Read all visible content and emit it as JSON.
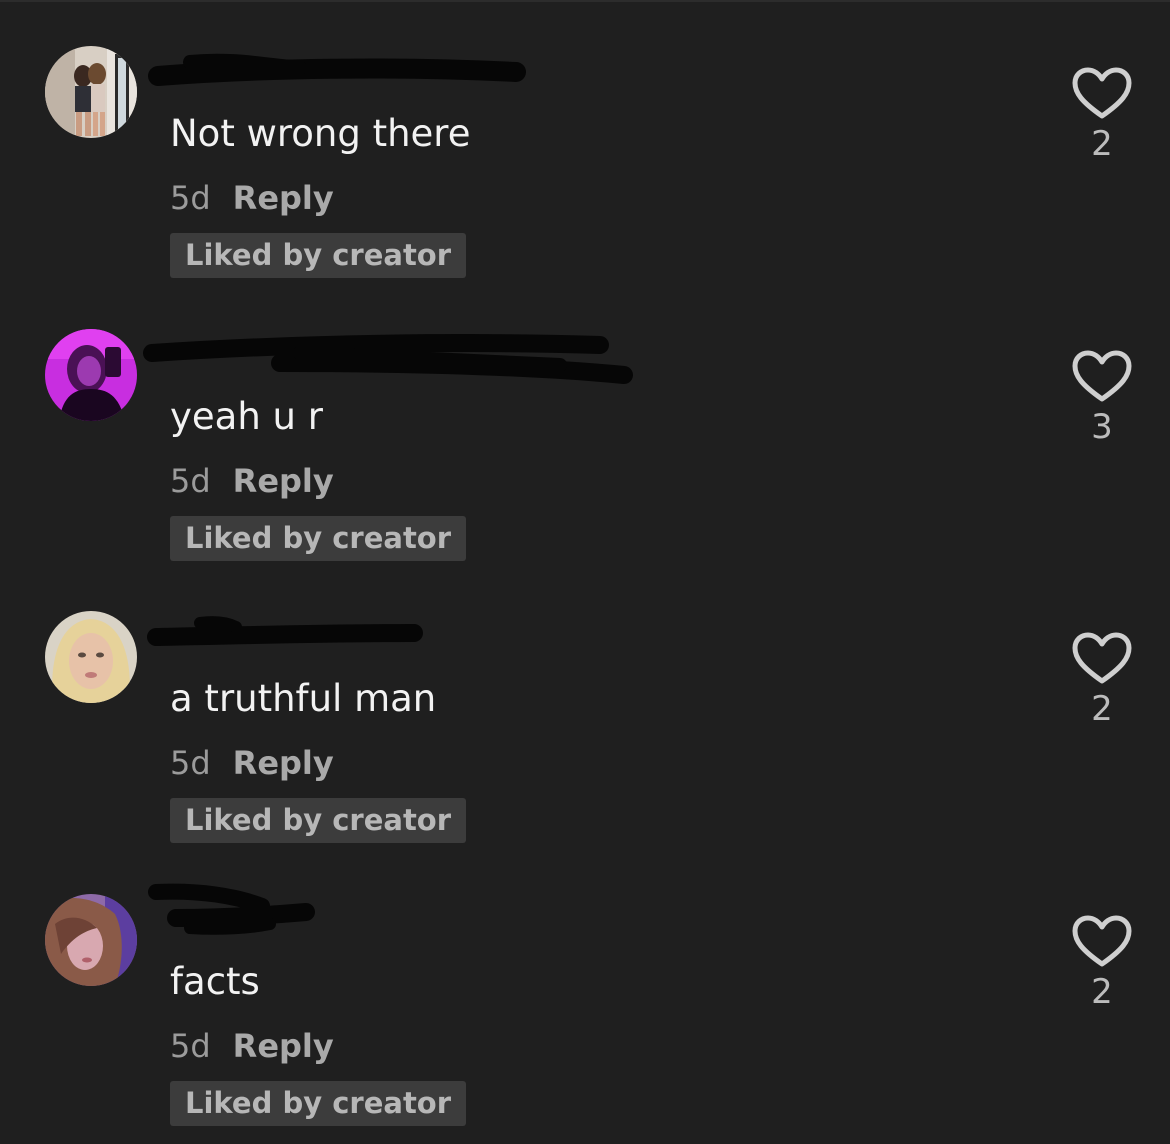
{
  "colors": {
    "background": "#1f1f1f",
    "badge_bg": "#3c3c3c",
    "muted_text": "#9b9b9b",
    "heart_outline": "#cfcfcf"
  },
  "comments": [
    {
      "avatar": "avatar-photo-1",
      "text": "Not wrong there",
      "age": "5d",
      "reply_label": "Reply",
      "badge": "Liked by creator",
      "like_icon": "heart-outline-icon",
      "likes": "2"
    },
    {
      "avatar": "avatar-photo-2",
      "text": "yeah u r",
      "age": "5d",
      "reply_label": "Reply",
      "badge": "Liked by creator",
      "like_icon": "heart-outline-icon",
      "likes": "3"
    },
    {
      "avatar": "avatar-photo-3",
      "text": "a truthful man",
      "age": "5d",
      "reply_label": "Reply",
      "badge": "Liked by creator",
      "like_icon": "heart-outline-icon",
      "likes": "2"
    },
    {
      "avatar": "avatar-photo-4",
      "text": "facts",
      "age": "5d",
      "reply_label": "Reply",
      "badge": "Liked by creator",
      "like_icon": "heart-outline-icon",
      "likes": "2"
    }
  ]
}
